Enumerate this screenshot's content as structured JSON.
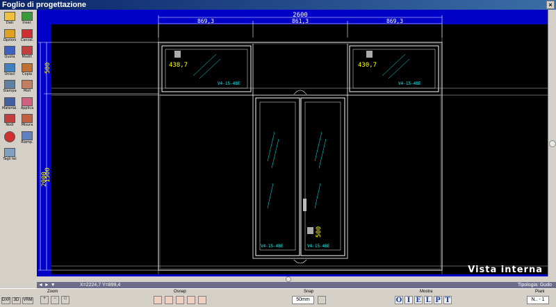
{
  "window": {
    "title": "Foglio di progettazione",
    "close_glyph": "×"
  },
  "toolbar": {
    "items": [
      {
        "label": "Dati",
        "icon": "data-icon"
      },
      {
        "label": "Inser.",
        "icon": "insert-icon"
      },
      {
        "label": "Opzioni",
        "icon": "options-icon"
      },
      {
        "label": "Cancel.",
        "icon": "delete-icon"
      },
      {
        "label": "Quota",
        "icon": "dimension-icon"
      },
      {
        "label": "Modif.",
        "icon": "edit-icon"
      },
      {
        "label": "Unisci",
        "icon": "merge-icon"
      },
      {
        "label": "Copia",
        "icon": "copy-icon"
      },
      {
        "label": "Stampa",
        "icon": "print-icon"
      },
      {
        "label": "Moll",
        "icon": "mull-icon"
      },
      {
        "label": "Material.",
        "icon": "material-icon"
      },
      {
        "label": "Applica",
        "icon": "apply-icon"
      },
      {
        "label": "Nodi",
        "icon": "nodes-icon"
      },
      {
        "label": "Misura",
        "icon": "measure-icon"
      },
      {
        "label": "",
        "icon": "exit-icon"
      },
      {
        "label": "Riemp.",
        "icon": "fill-icon"
      },
      {
        "label": "Tagli tel",
        "icon": "cut-icon"
      }
    ]
  },
  "drawing": {
    "total_width": "2600",
    "width_left": "869,3",
    "width_center": "861,3",
    "width_right": "869,3",
    "total_height": "2000",
    "height_top": "500",
    "height_bottom": "1500",
    "sash_left_dim": "438,7",
    "sash_right_dim": "430,7",
    "door_handle_dim": "500",
    "glass_top_left": "V4-15-4BE",
    "glass_top_right": "V4-15-4BE",
    "glass_door_left": "V4-15-4BE",
    "glass_door_right": "V4-15-4BE",
    "view_label": "Vista interna"
  },
  "status": {
    "coords": "X=2224,7  Y=899,4",
    "tipology": "Tipologia: Gudo"
  },
  "bottom": {
    "view_buttons": [
      "DXF",
      "3D",
      "VRM"
    ],
    "zoom_label": "Zoom",
    "osnap_label": "Osnap",
    "snap_label": "Snap",
    "snap_value": "50mm",
    "mostra_label": "Mostra",
    "mostra_buttons": [
      "O",
      "I",
      "E",
      "L",
      "P",
      "T"
    ],
    "piani_label": "Piani",
    "piani_value": "N.. - 1"
  },
  "colors": {
    "canvas_bg": "#000000",
    "frame": "#0000c8",
    "dimension": "#ffff00",
    "glass_text": "#00ffff",
    "lines": "#ffffff"
  }
}
